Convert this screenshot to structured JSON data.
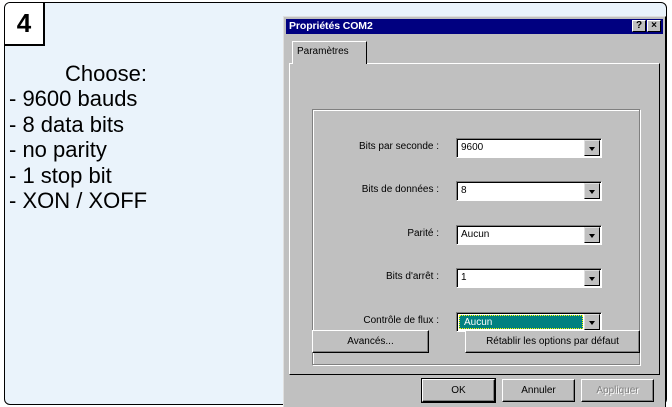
{
  "step": {
    "number": "4"
  },
  "instructions": {
    "heading": "Choose:",
    "items": [
      "- 9600 bauds",
      "- 8 data bits",
      "- no parity",
      "- 1 stop bit",
      "- XON / XOFF"
    ]
  },
  "dialog": {
    "title": "Propriétés COM2",
    "help_glyph": "?",
    "close_glyph": "×",
    "tab_label": "Paramètres",
    "fields": [
      {
        "label": "Bits par seconde :",
        "value": "9600"
      },
      {
        "label": "Bits de données :",
        "value": "8"
      },
      {
        "label": "Parité :",
        "value": "Aucun"
      },
      {
        "label": "Bits d'arrêt :",
        "value": "1"
      },
      {
        "label": "Contrôle de flux :",
        "value": "Aucun"
      }
    ],
    "advanced_button": "Avancés...",
    "restore_button": "Rétablir les options par défaut",
    "ok_button": "OK",
    "cancel_button": "Annuler",
    "apply_button": "Appliquer"
  },
  "colors": {
    "titlebar": "#000080",
    "face": "#c0c0c0",
    "selection": "#008080",
    "card_background": "#eaf3fb"
  }
}
